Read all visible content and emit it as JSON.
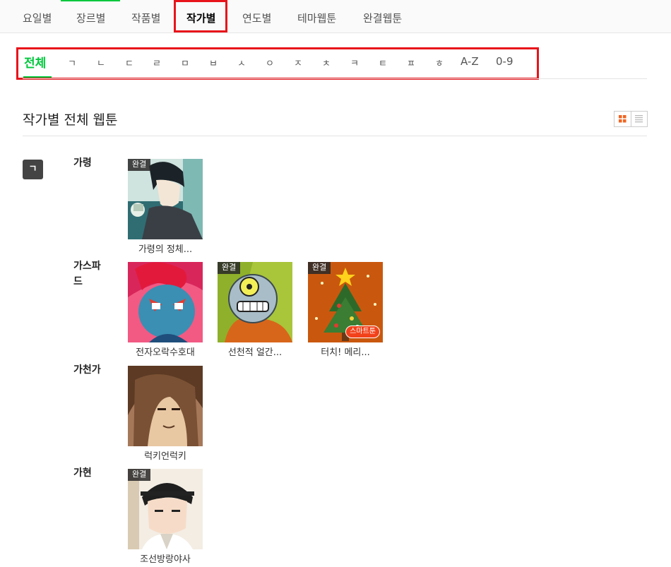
{
  "topnav": {
    "tabs": [
      "요일별",
      "장르별",
      "작품별",
      "작가별",
      "연도별",
      "테마웹툰",
      "완결웹툰"
    ],
    "active_tab": "작가별"
  },
  "alpha_filter": {
    "items": [
      "전체",
      "ㄱ",
      "ㄴ",
      "ㄷ",
      "ㄹ",
      "ㅁ",
      "ㅂ",
      "ㅅ",
      "ㅇ",
      "ㅈ",
      "ㅊ",
      "ㅋ",
      "ㅌ",
      "ㅍ",
      "ㅎ",
      "A-Z",
      "0-9"
    ],
    "active": "전체"
  },
  "section": {
    "title": "작가별 전체 웹툰",
    "initial": "ㄱ"
  },
  "authors": [
    {
      "name": "가령",
      "works": [
        {
          "title": "가령의 정체...",
          "badge": "완결"
        }
      ]
    },
    {
      "name": "가스파드",
      "works": [
        {
          "title": "전자오락수호대",
          "badge": ""
        },
        {
          "title": "선천적 얼간...",
          "badge": "완결"
        },
        {
          "title": "터치! 메리...",
          "badge": "완결",
          "tag": "스마트툰"
        }
      ]
    },
    {
      "name": "가천가",
      "works": [
        {
          "title": "럭키언럭키",
          "badge": ""
        }
      ]
    },
    {
      "name": "가현",
      "works": [
        {
          "title": "조선방랑야사",
          "badge": "완결"
        }
      ]
    }
  ],
  "colors": {
    "accent": "#00c73c",
    "highlight_box": "#e8141b",
    "grid_toggle": "#f26522"
  }
}
